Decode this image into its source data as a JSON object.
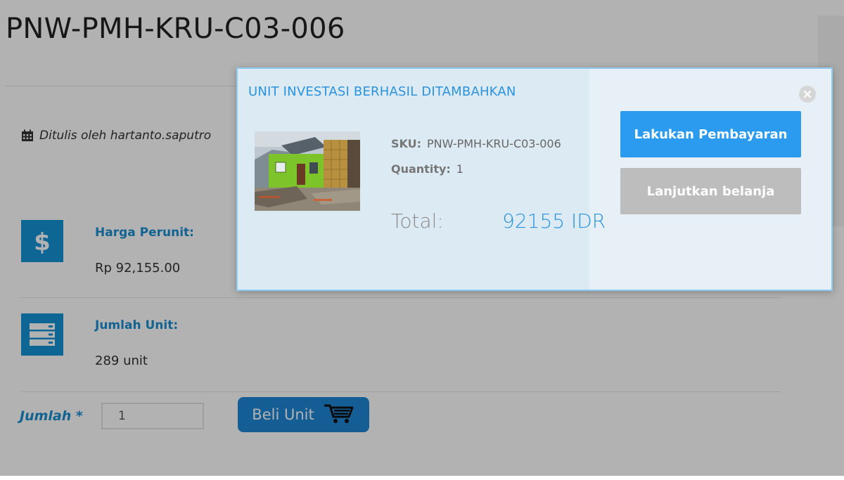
{
  "page": {
    "title": "PNW-PMH-KRU-C03-006"
  },
  "product": {
    "author": "Ditulis oleh hartanto.saputro",
    "price_label": "Harga Perunit:",
    "price_value": "Rp 92,155.00",
    "units_label": "Jumlah Unit:",
    "units_value": "289 unit",
    "qty_label": "Jumlah *",
    "qty_value": "1",
    "buy_label": "Beli Unit"
  },
  "modal": {
    "title": "UNIT INVESTASI BERHASIL DITAMBAHKAN",
    "sku_label": "SKU:",
    "sku_value": "PNW-PMH-KRU-C03-006",
    "quantity_label": "Quantity:",
    "quantity_value": "1",
    "total_label": "Total:",
    "total_value": "92155 IDR",
    "pay_button": "Lakukan Pembayaran",
    "continue_button": "Lanjutkan belanja"
  },
  "icons": {
    "author": "calendar-icon",
    "price": "dollar-icon",
    "units": "server-icon",
    "buy": "cart-icon",
    "close": "close-icon"
  },
  "colors": {
    "accent": "#1593d4",
    "buy_button": "#1e86d6",
    "pay_button": "#2b9bf0",
    "continue_button": "#bdbdbd",
    "modal_title": "#2a93dc"
  }
}
